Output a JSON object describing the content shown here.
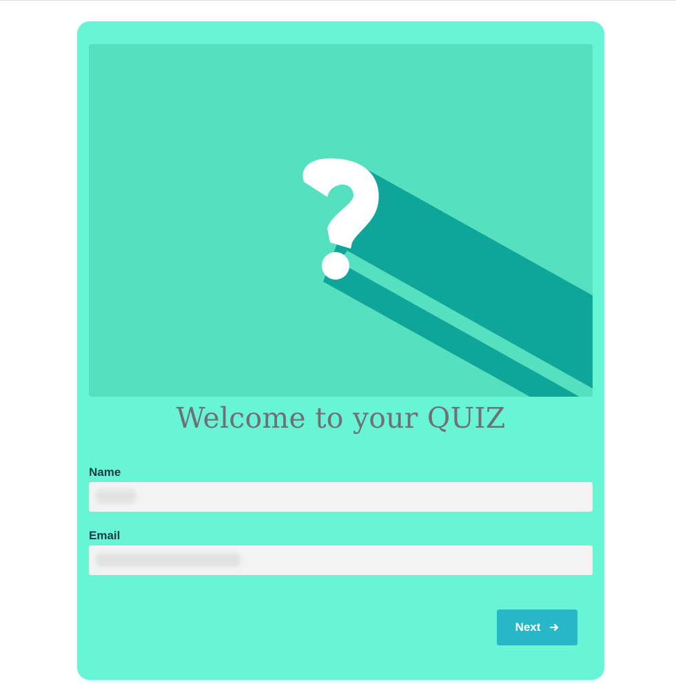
{
  "quiz": {
    "title": "Welcome to your QUIZ"
  },
  "form": {
    "name_label": "Name",
    "name_value": "",
    "email_label": "Email",
    "email_value": ""
  },
  "actions": {
    "next_label": "Next",
    "next_icon": "arrow-right-icon"
  },
  "hero": {
    "icon": "question-mark-icon"
  },
  "colors": {
    "card_background": "#67f5d6",
    "hero_background": "#55e0c0",
    "hero_shadow": "#0fa599",
    "button_background": "#27b7c9",
    "input_background": "#f3f3f3",
    "title_color": "#6f6f75",
    "label_color": "#1d3a48"
  }
}
